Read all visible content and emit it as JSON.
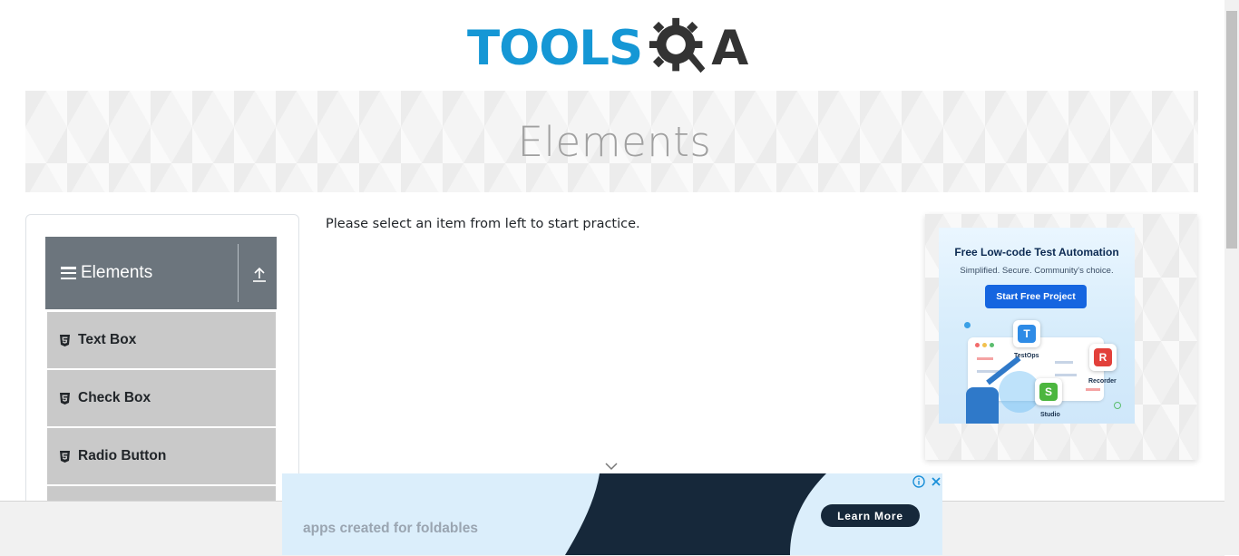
{
  "header": {
    "logo_tools": "TOOLS",
    "logo_qa": "A"
  },
  "banner": {
    "title": "Elements"
  },
  "sidebar": {
    "group_title": "Elements",
    "items": [
      {
        "label": "Text Box"
      },
      {
        "label": "Check Box"
      },
      {
        "label": "Radio Button"
      }
    ]
  },
  "main": {
    "message": "Please select an item from left to start practice."
  },
  "right_ad": {
    "heading": "Free Low-code Test Automation",
    "subheading": "Simplified. Secure. Community's choice.",
    "button": "Start Free Project",
    "tiles": [
      "TestOps",
      "Recorder",
      "Studio"
    ],
    "tile_letters": [
      "T",
      "R",
      "S"
    ]
  },
  "bottom_ad": {
    "text": "apps created for foldables",
    "button": "Learn More"
  },
  "colors": {
    "brand_blue": "#1597d5",
    "sidebar_header": "#6c757d",
    "menu_item_bg": "#c9c9c9",
    "ad_dark": "#16283a"
  }
}
